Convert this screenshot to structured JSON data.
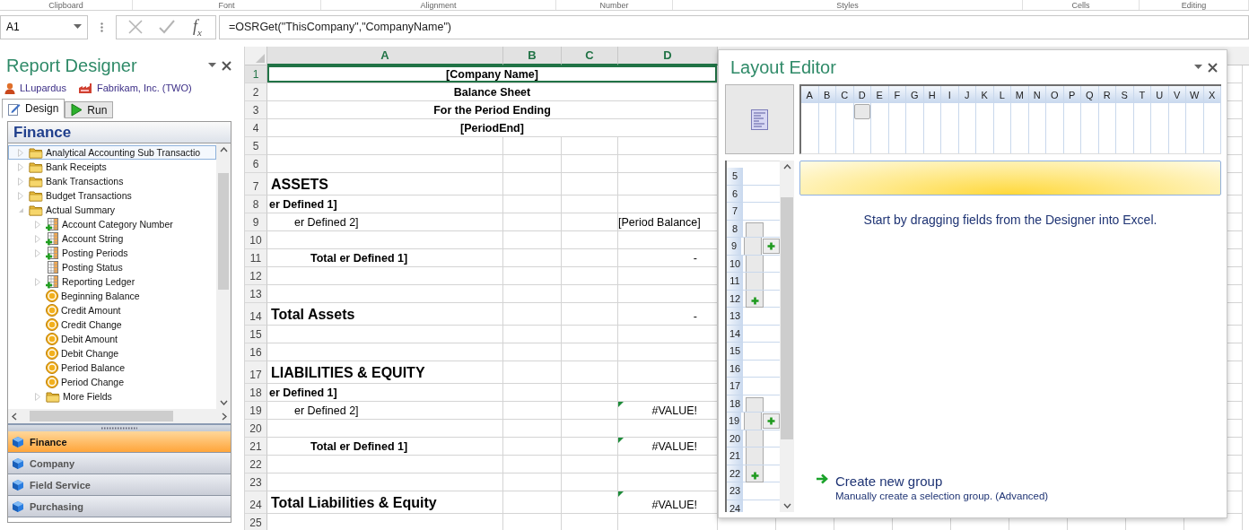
{
  "ribbon_groups": [
    "Clipboard",
    "Font",
    "Alignment",
    "Number",
    "Styles",
    "Cells",
    "Editing"
  ],
  "formula_bar": {
    "cell": "A1",
    "insert_function": "f$_{x}$",
    "formula": "=OSRGet(\"ThisCompany\",\"CompanyName\")"
  },
  "designer": {
    "title": "Report Designer",
    "user": "LLupardus",
    "company": "Fabrikam, Inc. (TWO)",
    "tabs": [
      {
        "label": "Design",
        "kind": "design",
        "selected": true
      },
      {
        "label": "Run",
        "kind": "run",
        "selected": false
      }
    ],
    "section": "Finance",
    "tree": [
      {
        "label": "Analytical Accounting Sub Transactio",
        "kind": "folder",
        "expanded": false,
        "selected": true
      },
      {
        "label": "Bank Receipts",
        "kind": "folder",
        "expanded": false,
        "selected": false
      },
      {
        "label": "Bank Transactions",
        "kind": "folder",
        "expanded": false,
        "selected": false
      },
      {
        "label": "Budget Transactions",
        "kind": "folder",
        "expanded": false,
        "selected": false
      },
      {
        "label": "Actual Summary",
        "kind": "folder",
        "expanded": true,
        "selected": false,
        "children": [
          {
            "label": "Account Category Number",
            "kind": "table-add",
            "expanded": false,
            "selected": false
          },
          {
            "label": "Account String",
            "kind": "table-add",
            "expanded": false,
            "selected": false
          },
          {
            "label": "Posting Periods",
            "kind": "table-add",
            "expanded": false,
            "selected": false
          },
          {
            "label": "Posting Status",
            "kind": "table",
            "selected": false
          },
          {
            "label": "Reporting Ledger",
            "kind": "table-add",
            "expanded": false,
            "selected": false
          },
          {
            "label": "Beginning Balance",
            "kind": "money",
            "selected": false
          },
          {
            "label": "Credit Amount",
            "kind": "money",
            "selected": false
          },
          {
            "label": "Credit Change",
            "kind": "money",
            "selected": false
          },
          {
            "label": "Debit Amount",
            "kind": "money",
            "selected": false
          },
          {
            "label": "Debit Change",
            "kind": "money",
            "selected": false
          },
          {
            "label": "Period Balance",
            "kind": "money",
            "selected": false
          },
          {
            "label": "Period Change",
            "kind": "money",
            "selected": false
          },
          {
            "label": "More Fields",
            "kind": "folder",
            "expanded": false,
            "selected": false
          }
        ]
      }
    ],
    "nav": [
      {
        "label": "Finance",
        "selected": true
      },
      {
        "label": "Company",
        "selected": false
      },
      {
        "label": "Field Service",
        "selected": false
      },
      {
        "label": "Purchasing",
        "selected": false
      }
    ]
  },
  "sheet": {
    "columns": [
      {
        "label": "A",
        "selected": true
      },
      {
        "label": "B",
        "selected": true
      },
      {
        "label": "C",
        "selected": true
      },
      {
        "label": "D",
        "selected": true
      }
    ],
    "rows": [
      {
        "number": "1",
        "kind": "title",
        "text": "[Company Name]",
        "selected": true
      },
      {
        "number": "2",
        "kind": "title",
        "text": "Balance Sheet",
        "selected": false
      },
      {
        "number": "3",
        "kind": "title",
        "text": "For the Period Ending",
        "selected": false
      },
      {
        "number": "4",
        "kind": "title",
        "text": "[PeriodEnd]",
        "selected": false
      },
      {
        "number": "5",
        "kind": "blank",
        "selected": false
      },
      {
        "number": "6",
        "kind": "blank",
        "selected": false
      },
      {
        "number": "7",
        "kind": "section",
        "text": "ASSETS",
        "selected": false
      },
      {
        "number": "8",
        "kind": "group",
        "text": "er Defined 1]",
        "selected": false
      },
      {
        "number": "9",
        "kind": "item",
        "text": "er Defined 2]",
        "value": "[Period Balance]",
        "flag": false,
        "selected": false
      },
      {
        "number": "10",
        "kind": "blank",
        "selected": false
      },
      {
        "number": "11",
        "kind": "total",
        "text": "Total er Defined 1]",
        "value": "-",
        "flag": false,
        "selected": false
      },
      {
        "number": "12",
        "kind": "blank",
        "selected": false
      },
      {
        "number": "13",
        "kind": "blank",
        "selected": false
      },
      {
        "number": "14",
        "kind": "section",
        "text": "Total Assets",
        "value": "-",
        "flag": false,
        "selected": false
      },
      {
        "number": "15",
        "kind": "blank",
        "selected": false
      },
      {
        "number": "16",
        "kind": "blank",
        "selected": false
      },
      {
        "number": "17",
        "kind": "section",
        "text": "LIABILITIES & EQUITY",
        "selected": false
      },
      {
        "number": "18",
        "kind": "group",
        "text": "er Defined 1]",
        "selected": false
      },
      {
        "number": "19",
        "kind": "item",
        "text": "er Defined 2]",
        "value": "#VALUE!",
        "flag": true,
        "selected": false
      },
      {
        "number": "20",
        "kind": "blank",
        "selected": false
      },
      {
        "number": "21",
        "kind": "total",
        "text": "Total er Defined 1]",
        "value": "#VALUE!",
        "flag": true,
        "selected": false
      },
      {
        "number": "22",
        "kind": "blank",
        "selected": false
      },
      {
        "number": "23",
        "kind": "blank",
        "selected": false
      },
      {
        "number": "24",
        "kind": "section",
        "text": "Total Liabilities & Equity",
        "value": "#VALUE!",
        "flag": true,
        "selected": false
      },
      {
        "number": "25",
        "kind": "blank",
        "selected": false
      }
    ]
  },
  "layout_editor": {
    "title": "Layout Editor",
    "columns": [
      {
        "label": "A",
        "occupied": false
      },
      {
        "label": "B",
        "occupied": false
      },
      {
        "label": "C",
        "occupied": false
      },
      {
        "label": "D",
        "occupied": true
      },
      {
        "label": "E",
        "occupied": false
      },
      {
        "label": "F",
        "occupied": false
      },
      {
        "label": "G",
        "occupied": false
      },
      {
        "label": "H",
        "occupied": false
      },
      {
        "label": "I",
        "occupied": false
      },
      {
        "label": "J",
        "occupied": false
      },
      {
        "label": "K",
        "occupied": false
      },
      {
        "label": "L",
        "occupied": false
      },
      {
        "label": "M",
        "occupied": false
      },
      {
        "label": "N",
        "occupied": false
      },
      {
        "label": "O",
        "occupied": false
      },
      {
        "label": "P",
        "occupied": false
      },
      {
        "label": "Q",
        "occupied": false
      },
      {
        "label": "R",
        "occupied": false
      },
      {
        "label": "S",
        "occupied": false
      },
      {
        "label": "T",
        "occupied": false
      },
      {
        "label": "U",
        "occupied": false
      },
      {
        "label": "V",
        "occupied": false
      },
      {
        "label": "W",
        "occupied": false
      },
      {
        "label": "X",
        "occupied": false
      }
    ],
    "rows": [
      {
        "label": "5",
        "kind": "plain",
        "add_button": false
      },
      {
        "label": "6",
        "kind": "plain",
        "add_button": false
      },
      {
        "label": "7",
        "kind": "plain",
        "add_button": false
      },
      {
        "label": "8",
        "kind": "group-start",
        "add_button": false
      },
      {
        "label": "9",
        "kind": "group-middle",
        "add_button": true
      },
      {
        "label": "10",
        "kind": "group-middle",
        "add_button": false
      },
      {
        "label": "11",
        "kind": "group-middle",
        "add_button": false
      },
      {
        "label": "12",
        "kind": "group-end",
        "add_button": false
      },
      {
        "label": "13",
        "kind": "plain",
        "add_button": false
      },
      {
        "label": "14",
        "kind": "plain",
        "add_button": false
      },
      {
        "label": "15",
        "kind": "plain",
        "add_button": false
      },
      {
        "label": "16",
        "kind": "plain",
        "add_button": false
      },
      {
        "label": "17",
        "kind": "plain",
        "add_button": false
      },
      {
        "label": "18",
        "kind": "group-start",
        "add_button": false
      },
      {
        "label": "19",
        "kind": "group-middle",
        "add_button": true
      },
      {
        "label": "20",
        "kind": "group-middle",
        "add_button": false
      },
      {
        "label": "21",
        "kind": "group-middle",
        "add_button": false
      },
      {
        "label": "22",
        "kind": "group-end",
        "add_button": false
      },
      {
        "label": "23",
        "kind": "plain",
        "add_button": false
      },
      {
        "label": "24",
        "kind": "plain",
        "add_button": false
      }
    ],
    "message": "Start by dragging fields from the Designer into Excel.",
    "action": {
      "label": "Create new group",
      "description": "Manually create a selection group. (Advanced)"
    }
  }
}
